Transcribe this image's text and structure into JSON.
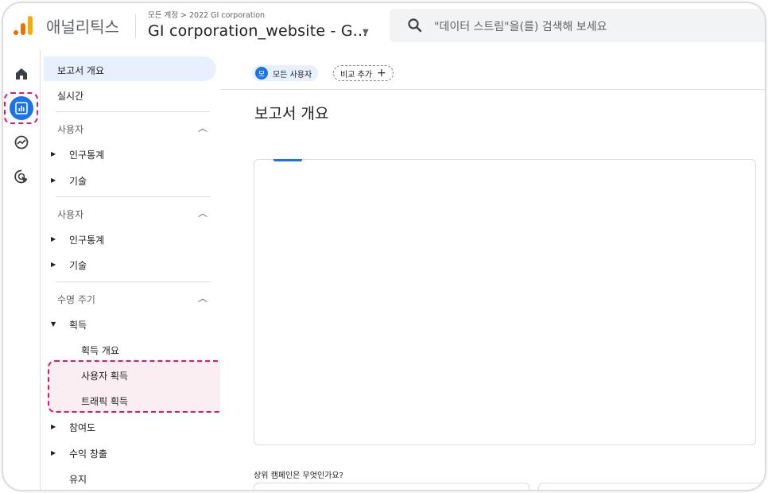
{
  "header": {
    "app_name": "애널리틱스",
    "breadcrumb": "모든 계정 > 2022 GI corporation",
    "property": "GI corporation_website - G...",
    "search_placeholder": "\"데이터 스트림\"을(를) 검색해 보세요"
  },
  "rail": {
    "icons": [
      "home-icon",
      "reports-icon",
      "explore-icon",
      "advertising-icon"
    ],
    "active": "reports-icon",
    "accent_color": "#1a73e8",
    "highlight_color": "#e0186c"
  },
  "sidebar": {
    "report_overview": "보고서 개요",
    "realtime": "실시간",
    "section1": {
      "title": "사용자",
      "items": [
        "인구통계",
        "기술"
      ]
    },
    "section2": {
      "title": "사용자",
      "items": [
        "인구통계",
        "기술"
      ]
    },
    "section3": {
      "title": "수명 주기",
      "acquisition": "획득",
      "acquisition_children": [
        "획득 개요",
        "사용자 획득",
        "트래픽 획득"
      ],
      "others": [
        "참여도",
        "수익 창출",
        "유지"
      ]
    }
  },
  "main": {
    "chip_badge": "모",
    "chip_all_users": "모든 사용자",
    "chip_compare": "비교 추가",
    "chip_compare_plus": "+",
    "title": "보고서 개요",
    "question": "상위 캠페인은 무엇인가요?"
  }
}
